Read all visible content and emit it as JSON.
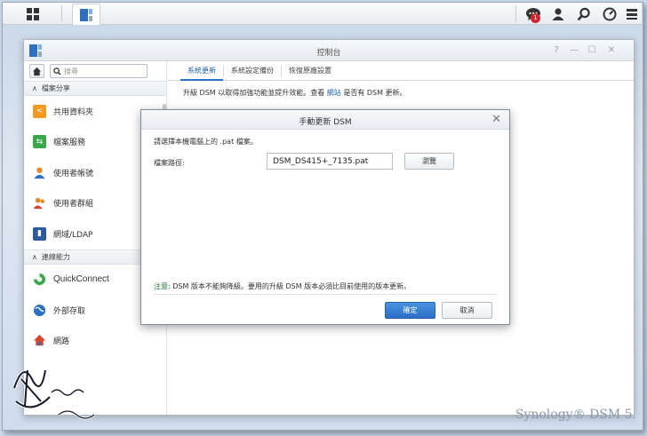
{
  "taskbar": {
    "notification_count": "1"
  },
  "window": {
    "title": "控制台"
  },
  "sidebar": {
    "search_placeholder": "搜尋",
    "sections": [
      {
        "label": "檔案分享"
      },
      {
        "label": "連線能力"
      }
    ],
    "items": [
      {
        "label": "共用資料夾",
        "icon": "shared-folder-icon",
        "color": "#f29a1f"
      },
      {
        "label": "檔案服務",
        "icon": "file-services-icon",
        "color": "#3aa84a"
      },
      {
        "label": "使用者帳號",
        "icon": "user-icon",
        "color": "#e38b2c"
      },
      {
        "label": "使用者群組",
        "icon": "group-icon",
        "color": "#e38b2c"
      },
      {
        "label": "網域/LDAP",
        "icon": "domain-ldap-icon",
        "color": "#2e5aa0"
      },
      {
        "label": "QuickConnect",
        "icon": "quickconnect-icon",
        "color": "#3aa84a"
      },
      {
        "label": "外部存取",
        "icon": "external-access-icon",
        "color": "#2f6fc0"
      },
      {
        "label": "網路",
        "icon": "network-icon",
        "color": "#d6452f"
      }
    ]
  },
  "main": {
    "tabs": [
      {
        "label": "系統更新"
      },
      {
        "label": "系統設定備份"
      },
      {
        "label": "恢復原廠設置"
      }
    ],
    "notice_prefix": "升級 DSM 以取得加強功能並提升效能。查看",
    "notice_link": "網站",
    "notice_suffix": "是否有 DSM 更新。"
  },
  "dialog": {
    "title": "手動更新 DSM",
    "instruction": "請選擇本機電腦上的 .pat 檔案。",
    "path_label": "檔案路徑:",
    "path_value": "DSM_DS415+_7135.pat",
    "browse_label": "瀏覽",
    "note_label": "注意:",
    "note_text": "DSM 版本不能夠降級。要用的升級 DSM 版本必須比目前使用的版本更新。",
    "ok_label": "確定",
    "cancel_label": "取消"
  },
  "brand": {
    "text": "Synology® DSM 5."
  },
  "colors": {
    "accent": "#2c73c7",
    "link": "#1f5fa6",
    "badge": "#d4242b"
  }
}
